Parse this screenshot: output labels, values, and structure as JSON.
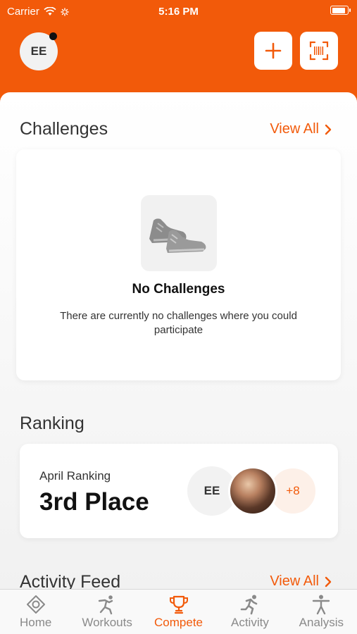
{
  "status_bar": {
    "carrier": "Carrier",
    "time": "5:16 PM"
  },
  "header": {
    "avatar_initials": "EE"
  },
  "challenges": {
    "title": "Challenges",
    "view_all": "View All",
    "empty_title": "No Challenges",
    "empty_text": "There are currently no challenges where you could participate"
  },
  "ranking": {
    "title": "Ranking",
    "label": "April Ranking",
    "value": "3rd Place",
    "avatar_initials": "EE",
    "more_count": "+8"
  },
  "activity_feed": {
    "title": "Activity Feed",
    "view_all": "View All"
  },
  "tabs": [
    {
      "label": "Home",
      "icon": "home-icon"
    },
    {
      "label": "Workouts",
      "icon": "workouts-icon"
    },
    {
      "label": "Compete",
      "icon": "trophy-icon"
    },
    {
      "label": "Activity",
      "icon": "running-icon"
    },
    {
      "label": "Analysis",
      "icon": "person-icon"
    }
  ],
  "colors": {
    "accent": "#f25a0a",
    "background": "#f5f5f5",
    "active_tab": "#f25a0a",
    "inactive_tab": "#8a8a8a"
  }
}
